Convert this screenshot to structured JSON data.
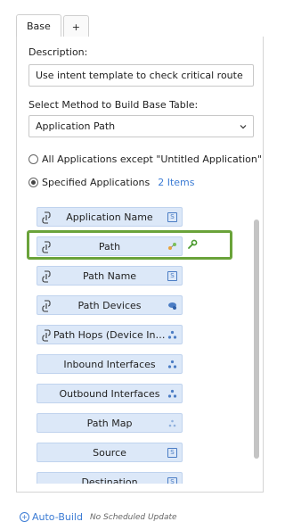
{
  "tabs": [
    {
      "label": "Base"
    },
    {
      "label": "+"
    }
  ],
  "description": {
    "label": "Description:",
    "value": "Use intent template to check critical route"
  },
  "method": {
    "label": "Select Method to Build Base Table:",
    "selected": "Application Path"
  },
  "scope": {
    "option_all": "All Applications except \"Untitled Application\"",
    "option_specified": "Specified Applications",
    "items_count": "2 Items"
  },
  "fields": [
    {
      "label": "Application Name",
      "icon": "text-type-icon"
    },
    {
      "label": "Path",
      "icon": "path-link-icon",
      "selected": true
    },
    {
      "label": "Path Name",
      "icon": "text-type-icon"
    },
    {
      "label": "Path Devices",
      "icon": "devices-icon"
    },
    {
      "label": "Path Hops (Device Inte...",
      "icon": "hops-icon"
    },
    {
      "label": "Inbound Interfaces",
      "icon": "interfaces-icon"
    },
    {
      "label": "Outbound Interfaces",
      "icon": "interfaces-icon"
    },
    {
      "label": "Path Map",
      "icon": "map-icon"
    },
    {
      "label": "Source",
      "icon": "text-type-icon"
    },
    {
      "label": "Destination",
      "icon": "text-type-icon"
    }
  ],
  "footer": {
    "autobuild_label": "Auto-Build",
    "schedule_text": "No Scheduled Update"
  },
  "colors": {
    "accent": "#3b7bd4",
    "item_bg": "#dce8f8",
    "highlight": "#6aa33a",
    "wrench": "#4a9a2e"
  }
}
